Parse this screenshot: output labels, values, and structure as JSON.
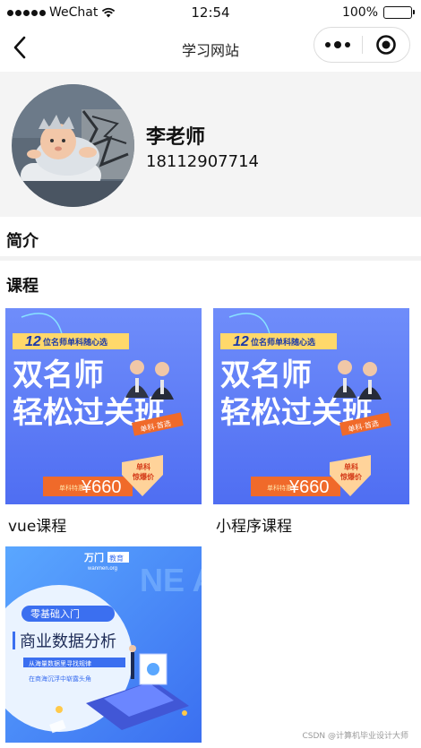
{
  "status_bar": {
    "carrier": "WeChat",
    "time": "12:54",
    "battery": "100%"
  },
  "nav": {
    "title": "学习网站"
  },
  "profile": {
    "name": "李老师",
    "phone": "18112907714"
  },
  "sections": {
    "intro": "简介",
    "courses": "课程"
  },
  "courses": [
    {
      "label": "vue课程",
      "banner": {
        "badge_num": "12",
        "badge_text": "位名师单科随心选",
        "title1": "双名师",
        "title2": "轻松过关班",
        "tag": "单科·首选",
        "price_prefix": "单科特惠",
        "price": "¥660",
        "ribbon": "单科\n惊爆价"
      }
    },
    {
      "label": "小程序课程",
      "banner": {
        "badge_num": "12",
        "badge_text": "位名师单科随心选",
        "title1": "双名师",
        "title2": "轻松过关班",
        "tag": "单科·首选",
        "price_prefix": "单科特惠",
        "price": "¥660",
        "ribbon": "单科\n惊爆价"
      }
    },
    {
      "label": "",
      "banner": {
        "brand": "万门",
        "brand_tag": "教育",
        "brand_site": "wanmen.org",
        "pill": "零基础入门",
        "title": "商业数据分析",
        "sub1": "从海量数据里寻找规律",
        "sub2": "在商海沉浮中崭露头角",
        "bg_letters": "NE AN"
      }
    }
  ],
  "watermark": "CSDN @计算机毕业设计大师",
  "colors": {
    "banner_blue": "#5a7cf6",
    "price_orange": "#f06a2a",
    "profile_bg": "#f4f4f4"
  }
}
